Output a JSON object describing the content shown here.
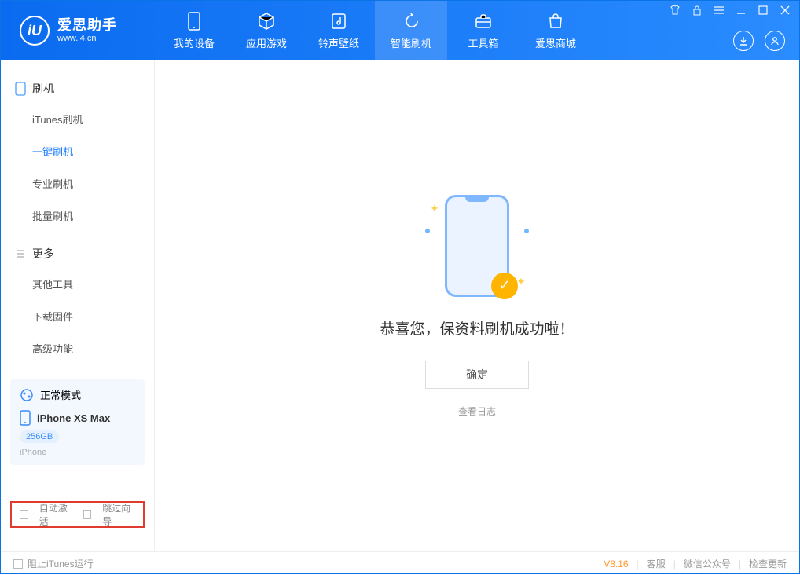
{
  "app": {
    "name_cn": "爱思助手",
    "name_en": "www.i4.cn"
  },
  "tabs": [
    {
      "label": "我的设备",
      "icon": "device"
    },
    {
      "label": "应用游戏",
      "icon": "cube"
    },
    {
      "label": "铃声壁纸",
      "icon": "music"
    },
    {
      "label": "智能刷机",
      "icon": "refresh",
      "active": true
    },
    {
      "label": "工具箱",
      "icon": "toolbox"
    },
    {
      "label": "爱思商城",
      "icon": "bag"
    }
  ],
  "sidebar": {
    "group1_label": "刷机",
    "group1_items": [
      "iTunes刷机",
      "一键刷机",
      "专业刷机",
      "批量刷机"
    ],
    "group1_active_index": 1,
    "group2_label": "更多",
    "group2_items": [
      "其他工具",
      "下载固件",
      "高级功能"
    ]
  },
  "mode": {
    "label": "正常模式"
  },
  "device": {
    "name": "iPhone XS Max",
    "storage": "256GB",
    "type": "iPhone"
  },
  "bottom_checks": {
    "auto_activate": "自动激活",
    "skip_guide": "跳过向导"
  },
  "main": {
    "success_text": "恭喜您，保资料刷机成功啦！",
    "ok_button": "确定",
    "view_log": "查看日志"
  },
  "statusbar": {
    "stop_itunes": "阻止iTunes运行",
    "version": "V8.16",
    "links": [
      "客服",
      "微信公众号",
      "检查更新"
    ]
  }
}
